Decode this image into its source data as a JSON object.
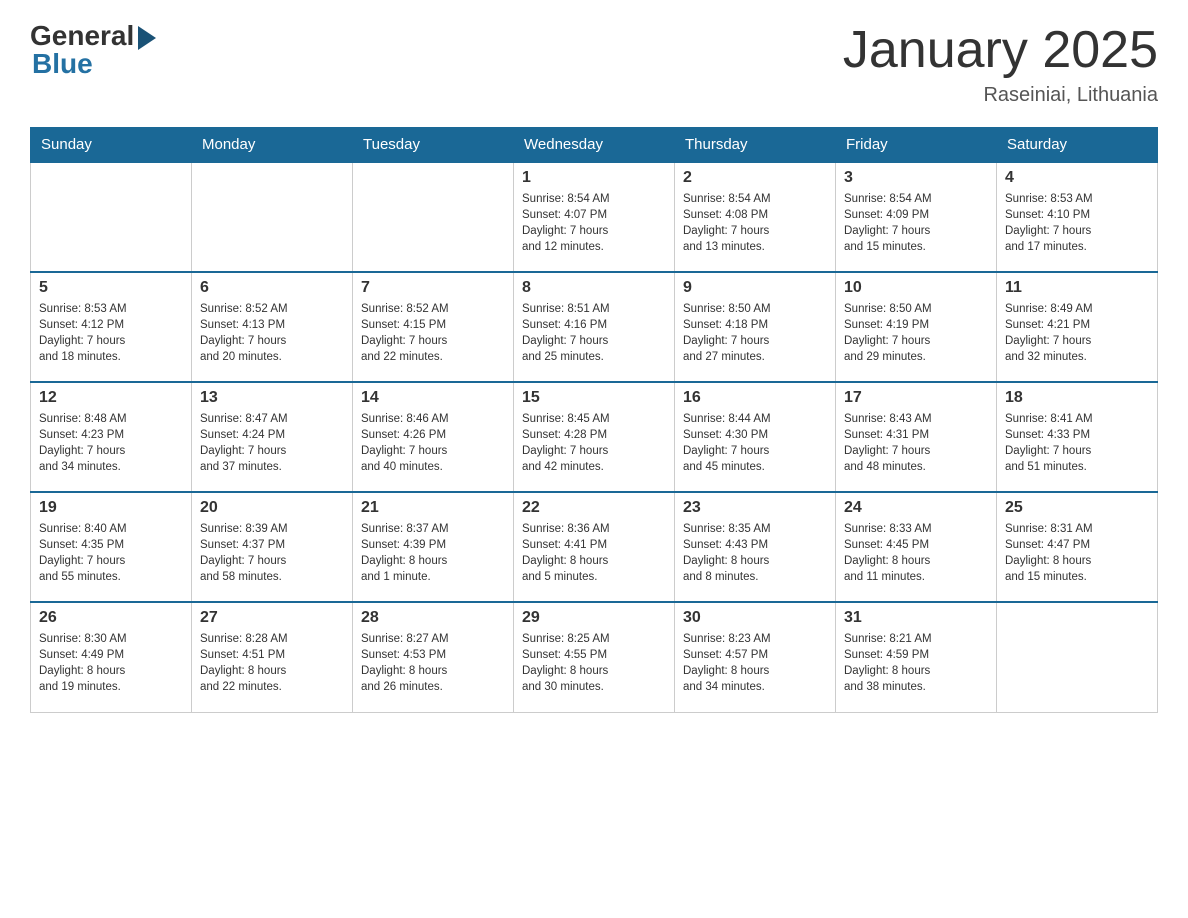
{
  "header": {
    "logo": {
      "general": "General",
      "blue": "Blue"
    },
    "title": "January 2025",
    "location": "Raseiniai, Lithuania"
  },
  "weekdays": [
    "Sunday",
    "Monday",
    "Tuesday",
    "Wednesday",
    "Thursday",
    "Friday",
    "Saturday"
  ],
  "weeks": [
    [
      {
        "day": "",
        "info": ""
      },
      {
        "day": "",
        "info": ""
      },
      {
        "day": "",
        "info": ""
      },
      {
        "day": "1",
        "info": "Sunrise: 8:54 AM\nSunset: 4:07 PM\nDaylight: 7 hours\nand 12 minutes."
      },
      {
        "day": "2",
        "info": "Sunrise: 8:54 AM\nSunset: 4:08 PM\nDaylight: 7 hours\nand 13 minutes."
      },
      {
        "day": "3",
        "info": "Sunrise: 8:54 AM\nSunset: 4:09 PM\nDaylight: 7 hours\nand 15 minutes."
      },
      {
        "day": "4",
        "info": "Sunrise: 8:53 AM\nSunset: 4:10 PM\nDaylight: 7 hours\nand 17 minutes."
      }
    ],
    [
      {
        "day": "5",
        "info": "Sunrise: 8:53 AM\nSunset: 4:12 PM\nDaylight: 7 hours\nand 18 minutes."
      },
      {
        "day": "6",
        "info": "Sunrise: 8:52 AM\nSunset: 4:13 PM\nDaylight: 7 hours\nand 20 minutes."
      },
      {
        "day": "7",
        "info": "Sunrise: 8:52 AM\nSunset: 4:15 PM\nDaylight: 7 hours\nand 22 minutes."
      },
      {
        "day": "8",
        "info": "Sunrise: 8:51 AM\nSunset: 4:16 PM\nDaylight: 7 hours\nand 25 minutes."
      },
      {
        "day": "9",
        "info": "Sunrise: 8:50 AM\nSunset: 4:18 PM\nDaylight: 7 hours\nand 27 minutes."
      },
      {
        "day": "10",
        "info": "Sunrise: 8:50 AM\nSunset: 4:19 PM\nDaylight: 7 hours\nand 29 minutes."
      },
      {
        "day": "11",
        "info": "Sunrise: 8:49 AM\nSunset: 4:21 PM\nDaylight: 7 hours\nand 32 minutes."
      }
    ],
    [
      {
        "day": "12",
        "info": "Sunrise: 8:48 AM\nSunset: 4:23 PM\nDaylight: 7 hours\nand 34 minutes."
      },
      {
        "day": "13",
        "info": "Sunrise: 8:47 AM\nSunset: 4:24 PM\nDaylight: 7 hours\nand 37 minutes."
      },
      {
        "day": "14",
        "info": "Sunrise: 8:46 AM\nSunset: 4:26 PM\nDaylight: 7 hours\nand 40 minutes."
      },
      {
        "day": "15",
        "info": "Sunrise: 8:45 AM\nSunset: 4:28 PM\nDaylight: 7 hours\nand 42 minutes."
      },
      {
        "day": "16",
        "info": "Sunrise: 8:44 AM\nSunset: 4:30 PM\nDaylight: 7 hours\nand 45 minutes."
      },
      {
        "day": "17",
        "info": "Sunrise: 8:43 AM\nSunset: 4:31 PM\nDaylight: 7 hours\nand 48 minutes."
      },
      {
        "day": "18",
        "info": "Sunrise: 8:41 AM\nSunset: 4:33 PM\nDaylight: 7 hours\nand 51 minutes."
      }
    ],
    [
      {
        "day": "19",
        "info": "Sunrise: 8:40 AM\nSunset: 4:35 PM\nDaylight: 7 hours\nand 55 minutes."
      },
      {
        "day": "20",
        "info": "Sunrise: 8:39 AM\nSunset: 4:37 PM\nDaylight: 7 hours\nand 58 minutes."
      },
      {
        "day": "21",
        "info": "Sunrise: 8:37 AM\nSunset: 4:39 PM\nDaylight: 8 hours\nand 1 minute."
      },
      {
        "day": "22",
        "info": "Sunrise: 8:36 AM\nSunset: 4:41 PM\nDaylight: 8 hours\nand 5 minutes."
      },
      {
        "day": "23",
        "info": "Sunrise: 8:35 AM\nSunset: 4:43 PM\nDaylight: 8 hours\nand 8 minutes."
      },
      {
        "day": "24",
        "info": "Sunrise: 8:33 AM\nSunset: 4:45 PM\nDaylight: 8 hours\nand 11 minutes."
      },
      {
        "day": "25",
        "info": "Sunrise: 8:31 AM\nSunset: 4:47 PM\nDaylight: 8 hours\nand 15 minutes."
      }
    ],
    [
      {
        "day": "26",
        "info": "Sunrise: 8:30 AM\nSunset: 4:49 PM\nDaylight: 8 hours\nand 19 minutes."
      },
      {
        "day": "27",
        "info": "Sunrise: 8:28 AM\nSunset: 4:51 PM\nDaylight: 8 hours\nand 22 minutes."
      },
      {
        "day": "28",
        "info": "Sunrise: 8:27 AM\nSunset: 4:53 PM\nDaylight: 8 hours\nand 26 minutes."
      },
      {
        "day": "29",
        "info": "Sunrise: 8:25 AM\nSunset: 4:55 PM\nDaylight: 8 hours\nand 30 minutes."
      },
      {
        "day": "30",
        "info": "Sunrise: 8:23 AM\nSunset: 4:57 PM\nDaylight: 8 hours\nand 34 minutes."
      },
      {
        "day": "31",
        "info": "Sunrise: 8:21 AM\nSunset: 4:59 PM\nDaylight: 8 hours\nand 38 minutes."
      },
      {
        "day": "",
        "info": ""
      }
    ]
  ]
}
